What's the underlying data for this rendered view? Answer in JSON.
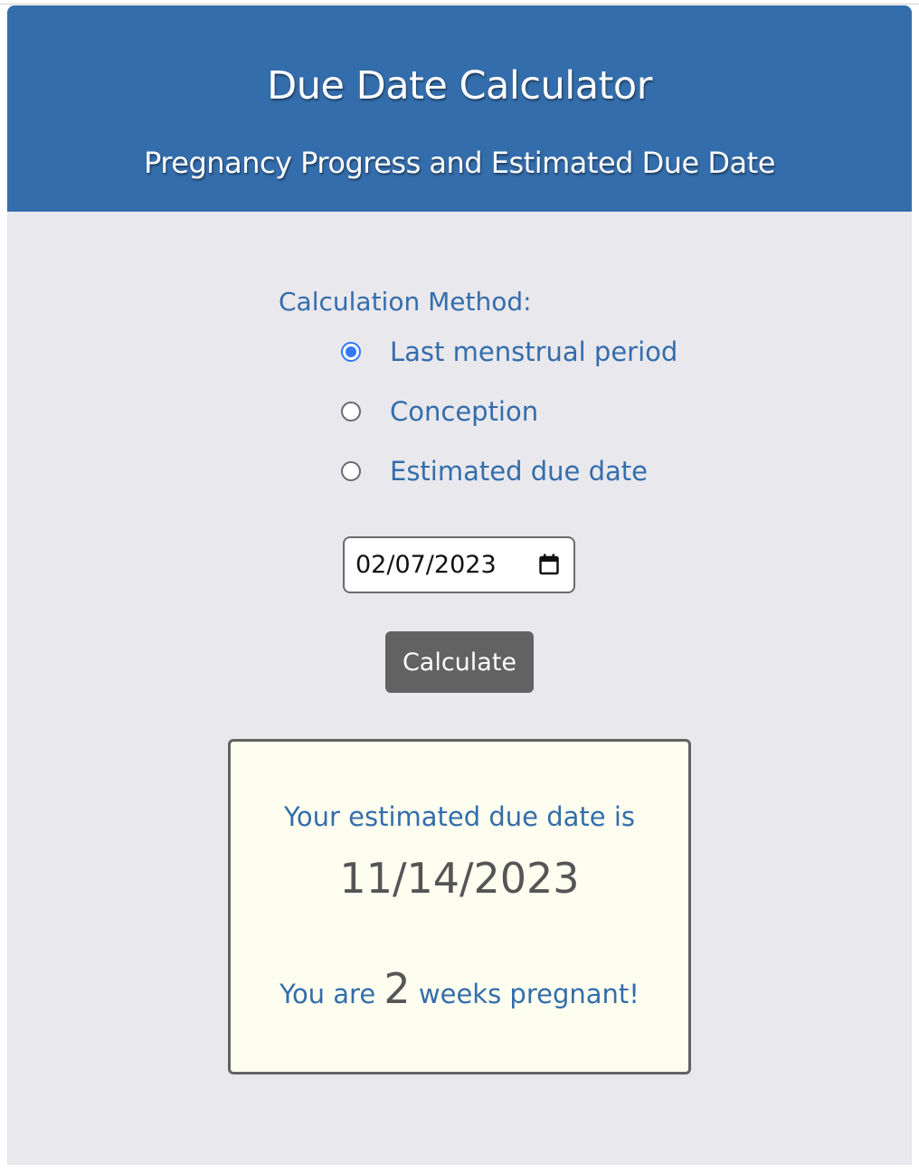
{
  "header": {
    "title": "Due Date Calculator",
    "subtitle": "Pregnancy Progress and Estimated Due Date"
  },
  "form": {
    "method_label": "Calculation Method:",
    "options": [
      {
        "label": "Last menstrual period",
        "checked": true
      },
      {
        "label": "Conception",
        "checked": false
      },
      {
        "label": "Estimated due date",
        "checked": false
      }
    ],
    "date_value": "02/07/2023",
    "calculate_label": "Calculate"
  },
  "result": {
    "due_prefix": "Your estimated due date is",
    "due_date": "11/14/2023",
    "weeks_prefix": "You are",
    "weeks": "2",
    "weeks_suffix": "weeks pregnant!"
  },
  "icons": {
    "date_picker": "calendar-icon"
  },
  "colors": {
    "header_bg": "#346dab",
    "accent_text": "#346dab",
    "page_bg": "#e9e8ed",
    "button_bg": "#636263",
    "result_bg": "#fdfef0",
    "radio_checked": "#3478f6"
  }
}
